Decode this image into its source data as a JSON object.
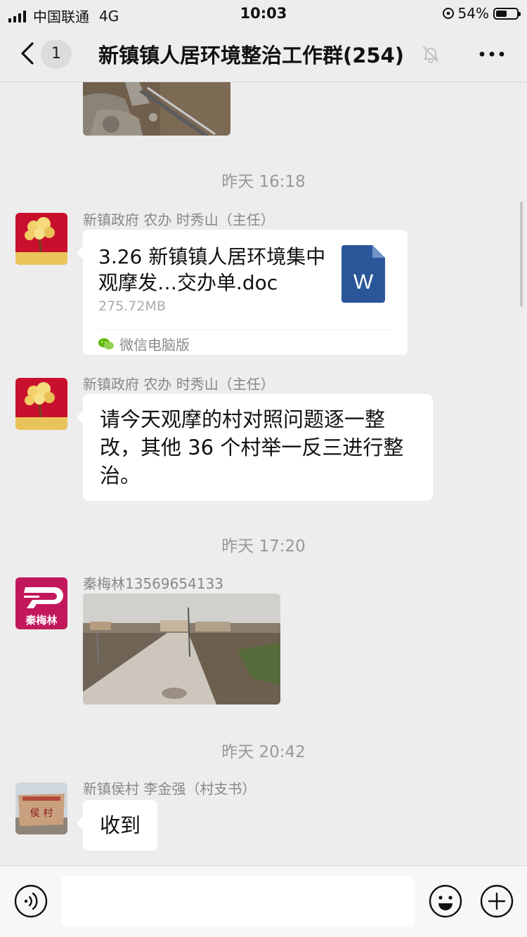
{
  "status_bar": {
    "carrier": "中国联通",
    "network": "4G",
    "time": "10:03",
    "battery": "54%",
    "battery_level": 0.54
  },
  "nav": {
    "unread_count": "1",
    "title": "新镇镇人居环境整治工作群(254)",
    "icons": [
      "back-icon",
      "mute-icon",
      "more-icon"
    ]
  },
  "messages": {
    "time1": "昨天 16:18",
    "m1": {
      "sender": "新镇政府 农办 时秀山（主任）",
      "file_name": "3.26 新镇镇人居环境集中观摩发…交办单.doc",
      "file_size": "275.72MB",
      "file_icon_letter": "W",
      "source": "微信电脑版"
    },
    "m2": {
      "sender": "新镇政府 农办 时秀山（主任）",
      "text": "请今天观摩的村对照问题逐一整改，其他 36 个村举一反三进行整治。"
    },
    "time2": "昨天 17:20",
    "m3": {
      "sender": "秦梅林13569654133",
      "avatar_text": "秦梅林"
    },
    "time3": "昨天 20:42",
    "m4": {
      "sender": "新镇侯村 李金强（村支书）",
      "text": "收到"
    }
  },
  "input": {
    "placeholder": "",
    "icons": [
      "voice-icon",
      "emoji-icon",
      "plus-icon"
    ]
  },
  "colors": {
    "background": "#ededed",
    "bubble": "#ffffff",
    "word_blue": "#2b579a",
    "avatar_red": "#c8102e",
    "avatar_pink": "#c2185b"
  }
}
